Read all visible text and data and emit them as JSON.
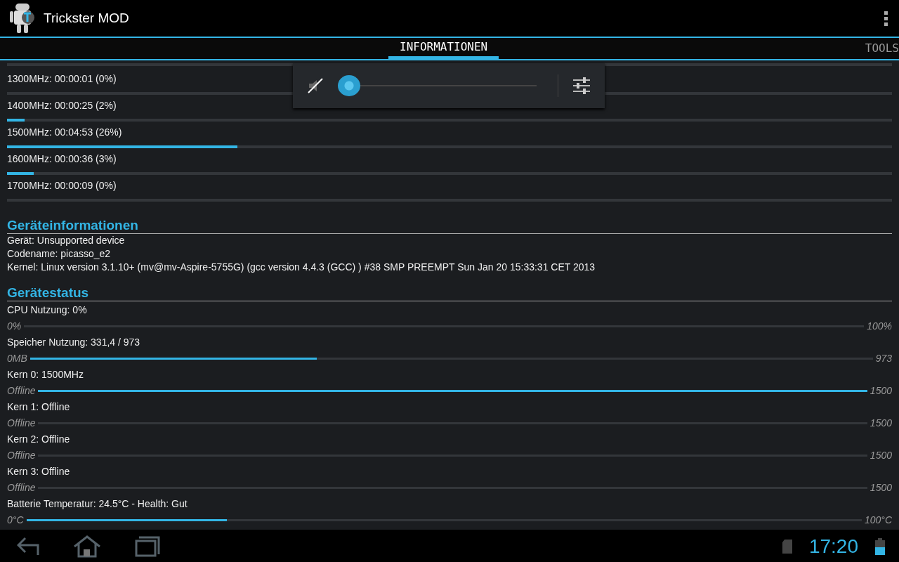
{
  "app_bar": {
    "title": "Trickster MOD"
  },
  "tabs": [
    {
      "label": "INFORMATIONEN",
      "selected": true
    },
    {
      "label": "TOOLS",
      "selected": false
    }
  ],
  "frequencies": [
    {
      "label": "1300MHz: 00:00:01 (0%)",
      "level": 0
    },
    {
      "label": "1400MHz: 00:00:25 (2%)",
      "level": 0.02
    },
    {
      "label": "1500MHz: 00:04:53 (26%)",
      "level": 0.26
    },
    {
      "label": "1600MHz: 00:00:36 (3%)",
      "level": 0.03
    },
    {
      "label": "1700MHz: 00:00:09 (0%)",
      "level": 0
    }
  ],
  "device_info": {
    "title": "Geräteinformationen",
    "lines": [
      "Gerät: Unsupported device",
      "Codename: picasso_e2",
      "Kernel: Linux version 3.1.10+ (mv@mv-Aspire-5755G) (gcc version 4.4.3 (GCC) ) #38 SMP PREEMPT Sun Jan 20 15:33:31 CET 2013"
    ]
  },
  "device_status": {
    "title": "Gerätestatus",
    "meters": [
      {
        "label": "CPU Nutzung: 0%",
        "min": "0%",
        "max": "100%",
        "level": 0
      },
      {
        "label": "Speicher Nutzung: 331,4 / 973",
        "min": "0MB",
        "max": "973",
        "level": 0.34
      },
      {
        "label": "Kern 0: 1500MHz",
        "min": "Offline",
        "max": "1500",
        "level": 1
      },
      {
        "label": "Kern 1: Offline",
        "min": "Offline",
        "max": "1500",
        "level": 0
      },
      {
        "label": "Kern 2: Offline",
        "min": "Offline",
        "max": "1500",
        "level": 0
      },
      {
        "label": "Kern 3: Offline",
        "min": "Offline",
        "max": "1500",
        "level": 0
      },
      {
        "label": "Batterie Temperatur: 24.5°C - Health: Gut",
        "min": "0°C",
        "max": "100°C",
        "level": 0.24
      }
    ]
  },
  "volume_popup": {
    "muted": true,
    "level": 0
  },
  "nav_bar": {
    "time": "17:20"
  }
}
